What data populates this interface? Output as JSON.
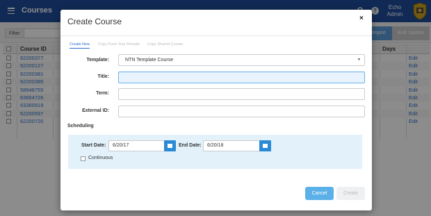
{
  "app": {
    "title": "Courses",
    "user_line1": "Echo",
    "user_line2": "Admin"
  },
  "toolbar": {
    "filter_label": "Filter",
    "import_label": "Import",
    "bulk_update_label": "Bulk Update"
  },
  "table": {
    "header_course_id": "Course ID",
    "header_days": "Days",
    "edit_label": "Edit",
    "rows": [
      "62200377",
      "62200127",
      "62200381",
      "62200385",
      "58648755",
      "63654726",
      "63360919",
      "62200597",
      "62200720"
    ]
  },
  "modal": {
    "title": "Create Course",
    "close": "×",
    "tabs": [
      "Create New",
      "Copy From Your Domain",
      "Copy Shared Course"
    ],
    "template_label": "Template:",
    "template_value": "NTN Template Course",
    "title_label": "Title:",
    "title_value": "",
    "term_label": "Term:",
    "term_value": "",
    "external_id_label": "External ID:",
    "external_id_value": "",
    "scheduling_label": "Scheduling",
    "start_date_label": "Start Date:",
    "start_date_value": "6/20/17",
    "end_date_label": "End Date:",
    "end_date_value": "6/20/18",
    "continuous_label": "Continuous",
    "cancel_label": "Cancel",
    "create_label": "Create"
  },
  "colors": {
    "topbar": "#1f4e9c",
    "accent": "#2a8ad6",
    "cancel_button": "#5bb0e8"
  }
}
